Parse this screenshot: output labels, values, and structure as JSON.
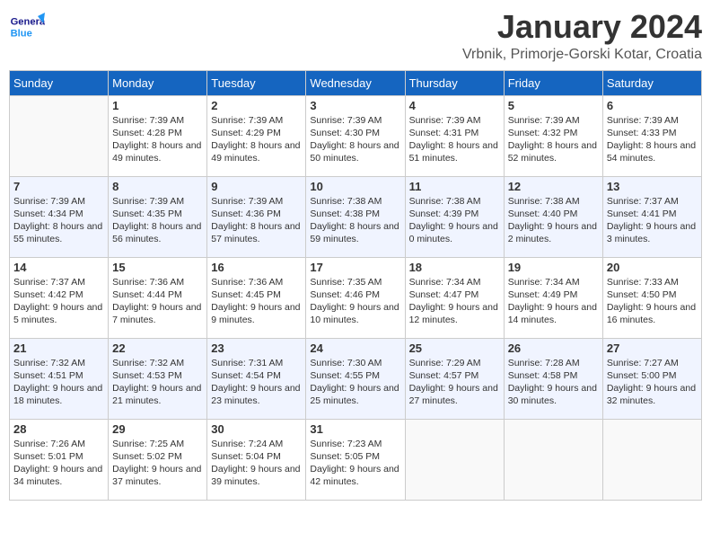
{
  "header": {
    "logo_general": "General",
    "logo_blue": "Blue",
    "month_title": "January 2024",
    "location": "Vrbnik, Primorje-Gorski Kotar, Croatia"
  },
  "weekdays": [
    "Sunday",
    "Monday",
    "Tuesday",
    "Wednesday",
    "Thursday",
    "Friday",
    "Saturday"
  ],
  "weeks": [
    [
      {
        "day": "",
        "sunrise": "",
        "sunset": "",
        "daylight": ""
      },
      {
        "day": "1",
        "sunrise": "Sunrise: 7:39 AM",
        "sunset": "Sunset: 4:28 PM",
        "daylight": "Daylight: 8 hours and 49 minutes."
      },
      {
        "day": "2",
        "sunrise": "Sunrise: 7:39 AM",
        "sunset": "Sunset: 4:29 PM",
        "daylight": "Daylight: 8 hours and 49 minutes."
      },
      {
        "day": "3",
        "sunrise": "Sunrise: 7:39 AM",
        "sunset": "Sunset: 4:30 PM",
        "daylight": "Daylight: 8 hours and 50 minutes."
      },
      {
        "day": "4",
        "sunrise": "Sunrise: 7:39 AM",
        "sunset": "Sunset: 4:31 PM",
        "daylight": "Daylight: 8 hours and 51 minutes."
      },
      {
        "day": "5",
        "sunrise": "Sunrise: 7:39 AM",
        "sunset": "Sunset: 4:32 PM",
        "daylight": "Daylight: 8 hours and 52 minutes."
      },
      {
        "day": "6",
        "sunrise": "Sunrise: 7:39 AM",
        "sunset": "Sunset: 4:33 PM",
        "daylight": "Daylight: 8 hours and 54 minutes."
      }
    ],
    [
      {
        "day": "7",
        "sunrise": "Sunrise: 7:39 AM",
        "sunset": "Sunset: 4:34 PM",
        "daylight": "Daylight: 8 hours and 55 minutes."
      },
      {
        "day": "8",
        "sunrise": "Sunrise: 7:39 AM",
        "sunset": "Sunset: 4:35 PM",
        "daylight": "Daylight: 8 hours and 56 minutes."
      },
      {
        "day": "9",
        "sunrise": "Sunrise: 7:39 AM",
        "sunset": "Sunset: 4:36 PM",
        "daylight": "Daylight: 8 hours and 57 minutes."
      },
      {
        "day": "10",
        "sunrise": "Sunrise: 7:38 AM",
        "sunset": "Sunset: 4:38 PM",
        "daylight": "Daylight: 8 hours and 59 minutes."
      },
      {
        "day": "11",
        "sunrise": "Sunrise: 7:38 AM",
        "sunset": "Sunset: 4:39 PM",
        "daylight": "Daylight: 9 hours and 0 minutes."
      },
      {
        "day": "12",
        "sunrise": "Sunrise: 7:38 AM",
        "sunset": "Sunset: 4:40 PM",
        "daylight": "Daylight: 9 hours and 2 minutes."
      },
      {
        "day": "13",
        "sunrise": "Sunrise: 7:37 AM",
        "sunset": "Sunset: 4:41 PM",
        "daylight": "Daylight: 9 hours and 3 minutes."
      }
    ],
    [
      {
        "day": "14",
        "sunrise": "Sunrise: 7:37 AM",
        "sunset": "Sunset: 4:42 PM",
        "daylight": "Daylight: 9 hours and 5 minutes."
      },
      {
        "day": "15",
        "sunrise": "Sunrise: 7:36 AM",
        "sunset": "Sunset: 4:44 PM",
        "daylight": "Daylight: 9 hours and 7 minutes."
      },
      {
        "day": "16",
        "sunrise": "Sunrise: 7:36 AM",
        "sunset": "Sunset: 4:45 PM",
        "daylight": "Daylight: 9 hours and 9 minutes."
      },
      {
        "day": "17",
        "sunrise": "Sunrise: 7:35 AM",
        "sunset": "Sunset: 4:46 PM",
        "daylight": "Daylight: 9 hours and 10 minutes."
      },
      {
        "day": "18",
        "sunrise": "Sunrise: 7:34 AM",
        "sunset": "Sunset: 4:47 PM",
        "daylight": "Daylight: 9 hours and 12 minutes."
      },
      {
        "day": "19",
        "sunrise": "Sunrise: 7:34 AM",
        "sunset": "Sunset: 4:49 PM",
        "daylight": "Daylight: 9 hours and 14 minutes."
      },
      {
        "day": "20",
        "sunrise": "Sunrise: 7:33 AM",
        "sunset": "Sunset: 4:50 PM",
        "daylight": "Daylight: 9 hours and 16 minutes."
      }
    ],
    [
      {
        "day": "21",
        "sunrise": "Sunrise: 7:32 AM",
        "sunset": "Sunset: 4:51 PM",
        "daylight": "Daylight: 9 hours and 18 minutes."
      },
      {
        "day": "22",
        "sunrise": "Sunrise: 7:32 AM",
        "sunset": "Sunset: 4:53 PM",
        "daylight": "Daylight: 9 hours and 21 minutes."
      },
      {
        "day": "23",
        "sunrise": "Sunrise: 7:31 AM",
        "sunset": "Sunset: 4:54 PM",
        "daylight": "Daylight: 9 hours and 23 minutes."
      },
      {
        "day": "24",
        "sunrise": "Sunrise: 7:30 AM",
        "sunset": "Sunset: 4:55 PM",
        "daylight": "Daylight: 9 hours and 25 minutes."
      },
      {
        "day": "25",
        "sunrise": "Sunrise: 7:29 AM",
        "sunset": "Sunset: 4:57 PM",
        "daylight": "Daylight: 9 hours and 27 minutes."
      },
      {
        "day": "26",
        "sunrise": "Sunrise: 7:28 AM",
        "sunset": "Sunset: 4:58 PM",
        "daylight": "Daylight: 9 hours and 30 minutes."
      },
      {
        "day": "27",
        "sunrise": "Sunrise: 7:27 AM",
        "sunset": "Sunset: 5:00 PM",
        "daylight": "Daylight: 9 hours and 32 minutes."
      }
    ],
    [
      {
        "day": "28",
        "sunrise": "Sunrise: 7:26 AM",
        "sunset": "Sunset: 5:01 PM",
        "daylight": "Daylight: 9 hours and 34 minutes."
      },
      {
        "day": "29",
        "sunrise": "Sunrise: 7:25 AM",
        "sunset": "Sunset: 5:02 PM",
        "daylight": "Daylight: 9 hours and 37 minutes."
      },
      {
        "day": "30",
        "sunrise": "Sunrise: 7:24 AM",
        "sunset": "Sunset: 5:04 PM",
        "daylight": "Daylight: 9 hours and 39 minutes."
      },
      {
        "day": "31",
        "sunrise": "Sunrise: 7:23 AM",
        "sunset": "Sunset: 5:05 PM",
        "daylight": "Daylight: 9 hours and 42 minutes."
      },
      {
        "day": "",
        "sunrise": "",
        "sunset": "",
        "daylight": ""
      },
      {
        "day": "",
        "sunrise": "",
        "sunset": "",
        "daylight": ""
      },
      {
        "day": "",
        "sunrise": "",
        "sunset": "",
        "daylight": ""
      }
    ]
  ]
}
